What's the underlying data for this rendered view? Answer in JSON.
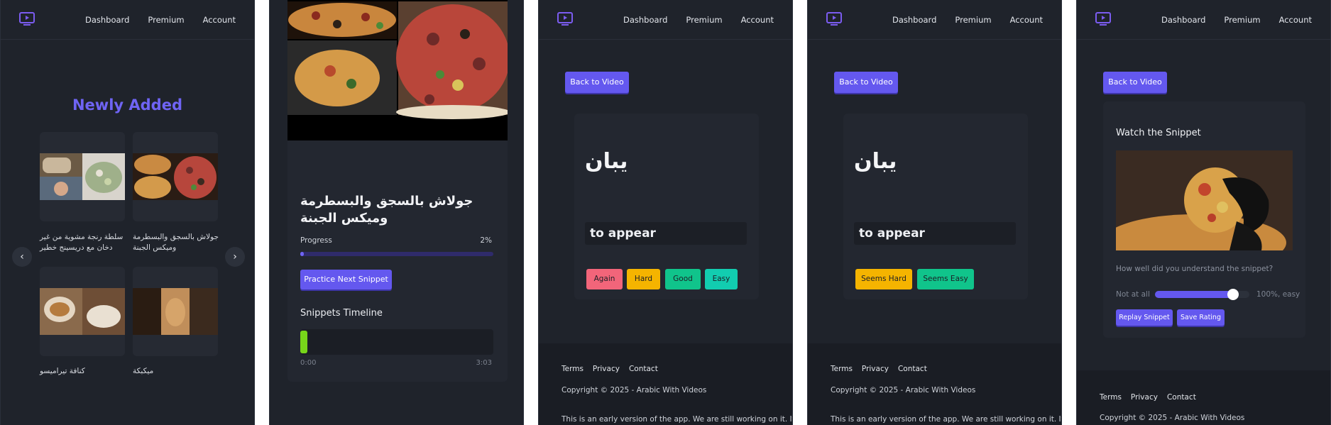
{
  "nav": {
    "links": [
      "Dashboard",
      "Premium",
      "Account"
    ]
  },
  "library": {
    "heading": "Newly Added",
    "cards": [
      {
        "title": "سلطة رنجة مشوية من غير دخان مع دريسينج خطير"
      },
      {
        "title": "جولاش بالسجق والبسطرمة وميكس الجبنة"
      },
      {
        "title": "كنافة تيراميسو"
      },
      {
        "title": "ميكبكة"
      }
    ],
    "prev_icon": "chevron-left-icon",
    "next_icon": "chevron-right-icon"
  },
  "video": {
    "title": "جولاش بالسجق والبسطرمة وميكس الجبنة",
    "progress_label": "Progress",
    "progress_value": "2%",
    "progress_fraction": 0.02,
    "practice_button": "Practice Next Snippet",
    "timeline_title": "Snippets Timeline",
    "time_start": "0:00",
    "time_end": "3:03"
  },
  "flashcard": {
    "back_button": "Back to Video",
    "word": "يبان",
    "translation": "to appear",
    "srs_buttons": [
      "Again",
      "Hard",
      "Good",
      "Easy"
    ],
    "simple_buttons": [
      "Seems Hard",
      "Seems Easy"
    ]
  },
  "snippet": {
    "back_button": "Back to Video",
    "title": "Watch the Snippet",
    "question": "How well did you understand the snippet?",
    "slider_min_label": "Not at all",
    "slider_max_label": "100%, easy",
    "slider_value_fraction": 1.0,
    "replay_button": "Replay Snippet",
    "save_button": "Save Rating"
  },
  "footer": {
    "links": [
      "Terms",
      "Privacy",
      "Contact"
    ],
    "copyright": "Copyright © 2025 - Arabic With Videos",
    "note": "This is an early version of the app. We are still working on it. If"
  },
  "colors": {
    "accent": "#6458ef",
    "again": "#f2657a",
    "hard": "#f5b400",
    "good": "#10c48b",
    "easy": "#12cdb0",
    "timeline_marker": "#77d51a"
  }
}
